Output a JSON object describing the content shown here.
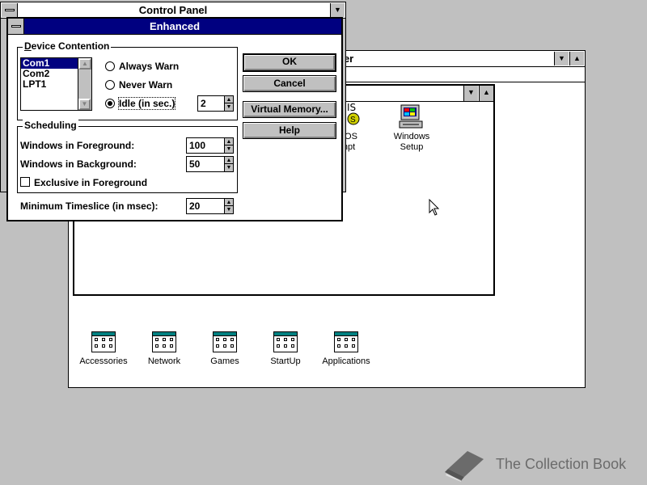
{
  "control_panel": {
    "title": "Control Panel"
  },
  "program_manager": {
    "title_fragment": "ger"
  },
  "dialog": {
    "title": "Enhanced",
    "device_contention": {
      "label": "Device Contention",
      "ports": [
        "Com1",
        "Com2",
        "LPT1"
      ],
      "selected": "Com1",
      "options": [
        "Always Warn",
        "Never Warn",
        "Idle (in sec.)"
      ],
      "selected_option": "Idle (in sec.)",
      "idle_value": "2"
    },
    "scheduling": {
      "label": "Scheduling",
      "foreground_label": "Windows in Foreground:",
      "foreground_value": "100",
      "background_label": "Windows in Background:",
      "background_value": "50",
      "exclusive_label": "Exclusive in Foreground",
      "exclusive_checked": false
    },
    "timeslice_label": "Minimum Timeslice (in msec):",
    "timeslice_value": "20",
    "buttons": {
      "ok": "OK",
      "cancel": "Cancel",
      "virtual_memory": "Virtual Memory...",
      "help": "Help"
    }
  },
  "main_group": {
    "icons": [
      {
        "label_line1": "DOS",
        "label_line2": "mpt",
        "icon": "ms-dos-prompt-icon"
      },
      {
        "label_line1": "Windows",
        "label_line2": "Setup",
        "icon": "windows-setup-icon"
      }
    ]
  },
  "group_icons": [
    {
      "label": "Accessories"
    },
    {
      "label": "Network"
    },
    {
      "label": "Games"
    },
    {
      "label": "StartUp"
    },
    {
      "label": "Applications"
    }
  ],
  "watermark": {
    "text": "The Collection Book",
    "icon": "book-icon"
  }
}
